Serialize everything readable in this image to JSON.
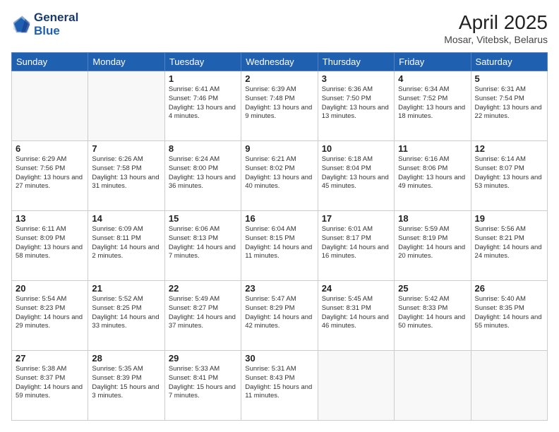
{
  "header": {
    "logo_line1": "General",
    "logo_line2": "Blue",
    "title": "April 2025",
    "subtitle": "Mosar, Vitebsk, Belarus"
  },
  "days_of_week": [
    "Sunday",
    "Monday",
    "Tuesday",
    "Wednesday",
    "Thursday",
    "Friday",
    "Saturday"
  ],
  "weeks": [
    [
      {
        "num": "",
        "info": ""
      },
      {
        "num": "",
        "info": ""
      },
      {
        "num": "1",
        "info": "Sunrise: 6:41 AM\nSunset: 7:46 PM\nDaylight: 13 hours\nand 4 minutes."
      },
      {
        "num": "2",
        "info": "Sunrise: 6:39 AM\nSunset: 7:48 PM\nDaylight: 13 hours\nand 9 minutes."
      },
      {
        "num": "3",
        "info": "Sunrise: 6:36 AM\nSunset: 7:50 PM\nDaylight: 13 hours\nand 13 minutes."
      },
      {
        "num": "4",
        "info": "Sunrise: 6:34 AM\nSunset: 7:52 PM\nDaylight: 13 hours\nand 18 minutes."
      },
      {
        "num": "5",
        "info": "Sunrise: 6:31 AM\nSunset: 7:54 PM\nDaylight: 13 hours\nand 22 minutes."
      }
    ],
    [
      {
        "num": "6",
        "info": "Sunrise: 6:29 AM\nSunset: 7:56 PM\nDaylight: 13 hours\nand 27 minutes."
      },
      {
        "num": "7",
        "info": "Sunrise: 6:26 AM\nSunset: 7:58 PM\nDaylight: 13 hours\nand 31 minutes."
      },
      {
        "num": "8",
        "info": "Sunrise: 6:24 AM\nSunset: 8:00 PM\nDaylight: 13 hours\nand 36 minutes."
      },
      {
        "num": "9",
        "info": "Sunrise: 6:21 AM\nSunset: 8:02 PM\nDaylight: 13 hours\nand 40 minutes."
      },
      {
        "num": "10",
        "info": "Sunrise: 6:18 AM\nSunset: 8:04 PM\nDaylight: 13 hours\nand 45 minutes."
      },
      {
        "num": "11",
        "info": "Sunrise: 6:16 AM\nSunset: 8:06 PM\nDaylight: 13 hours\nand 49 minutes."
      },
      {
        "num": "12",
        "info": "Sunrise: 6:14 AM\nSunset: 8:07 PM\nDaylight: 13 hours\nand 53 minutes."
      }
    ],
    [
      {
        "num": "13",
        "info": "Sunrise: 6:11 AM\nSunset: 8:09 PM\nDaylight: 13 hours\nand 58 minutes."
      },
      {
        "num": "14",
        "info": "Sunrise: 6:09 AM\nSunset: 8:11 PM\nDaylight: 14 hours\nand 2 minutes."
      },
      {
        "num": "15",
        "info": "Sunrise: 6:06 AM\nSunset: 8:13 PM\nDaylight: 14 hours\nand 7 minutes."
      },
      {
        "num": "16",
        "info": "Sunrise: 6:04 AM\nSunset: 8:15 PM\nDaylight: 14 hours\nand 11 minutes."
      },
      {
        "num": "17",
        "info": "Sunrise: 6:01 AM\nSunset: 8:17 PM\nDaylight: 14 hours\nand 16 minutes."
      },
      {
        "num": "18",
        "info": "Sunrise: 5:59 AM\nSunset: 8:19 PM\nDaylight: 14 hours\nand 20 minutes."
      },
      {
        "num": "19",
        "info": "Sunrise: 5:56 AM\nSunset: 8:21 PM\nDaylight: 14 hours\nand 24 minutes."
      }
    ],
    [
      {
        "num": "20",
        "info": "Sunrise: 5:54 AM\nSunset: 8:23 PM\nDaylight: 14 hours\nand 29 minutes."
      },
      {
        "num": "21",
        "info": "Sunrise: 5:52 AM\nSunset: 8:25 PM\nDaylight: 14 hours\nand 33 minutes."
      },
      {
        "num": "22",
        "info": "Sunrise: 5:49 AM\nSunset: 8:27 PM\nDaylight: 14 hours\nand 37 minutes."
      },
      {
        "num": "23",
        "info": "Sunrise: 5:47 AM\nSunset: 8:29 PM\nDaylight: 14 hours\nand 42 minutes."
      },
      {
        "num": "24",
        "info": "Sunrise: 5:45 AM\nSunset: 8:31 PM\nDaylight: 14 hours\nand 46 minutes."
      },
      {
        "num": "25",
        "info": "Sunrise: 5:42 AM\nSunset: 8:33 PM\nDaylight: 14 hours\nand 50 minutes."
      },
      {
        "num": "26",
        "info": "Sunrise: 5:40 AM\nSunset: 8:35 PM\nDaylight: 14 hours\nand 55 minutes."
      }
    ],
    [
      {
        "num": "27",
        "info": "Sunrise: 5:38 AM\nSunset: 8:37 PM\nDaylight: 14 hours\nand 59 minutes."
      },
      {
        "num": "28",
        "info": "Sunrise: 5:35 AM\nSunset: 8:39 PM\nDaylight: 15 hours\nand 3 minutes."
      },
      {
        "num": "29",
        "info": "Sunrise: 5:33 AM\nSunset: 8:41 PM\nDaylight: 15 hours\nand 7 minutes."
      },
      {
        "num": "30",
        "info": "Sunrise: 5:31 AM\nSunset: 8:43 PM\nDaylight: 15 hours\nand 11 minutes."
      },
      {
        "num": "",
        "info": ""
      },
      {
        "num": "",
        "info": ""
      },
      {
        "num": "",
        "info": ""
      }
    ]
  ]
}
